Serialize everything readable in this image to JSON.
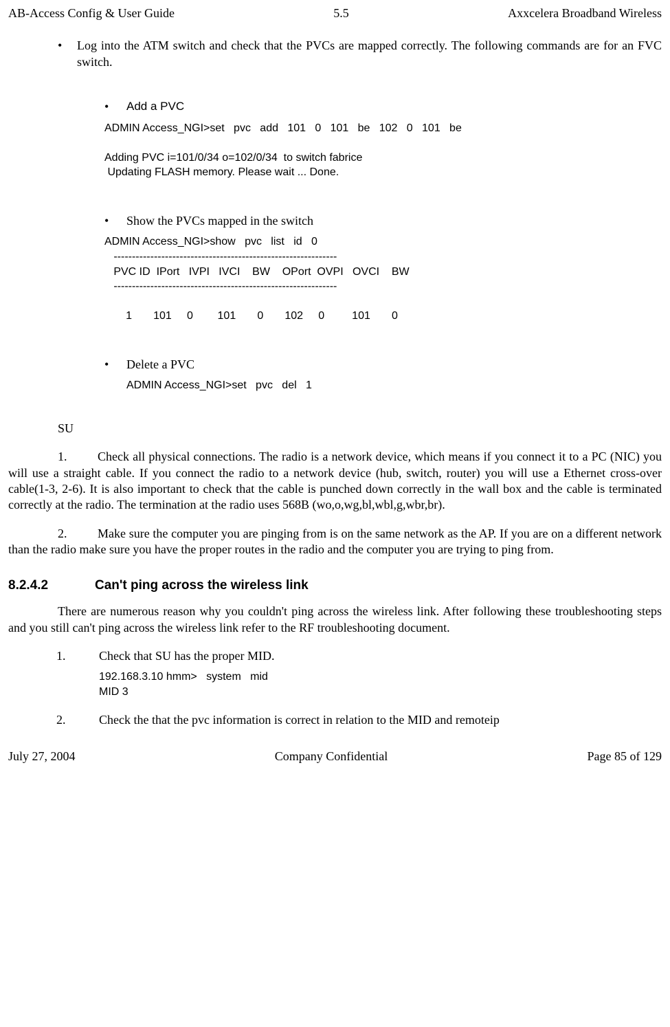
{
  "header": {
    "left": "AB-Access Config & User Guide",
    "center": "5.5",
    "right": "Axxcelera Broadband Wireless"
  },
  "footer": {
    "left": "July 27, 2004",
    "center": "Company Confidential",
    "right": "Page 85 of 129"
  },
  "mainBullet": "Log into the ATM switch and check that the PVCs are mapped correctly. The following commands are for an FVC switch.",
  "addPvc": {
    "title": "Add a PVC",
    "code": "ADMIN Access_NGI>set   pvc   add   101   0   101   be   102   0   101   be\n\nAdding PVC i=101/0/34 o=102/0/34  to switch fabrice\n Updating FLASH memory. Please wait ... Done."
  },
  "showPvc": {
    "title": "Show the PVCs mapped in the switch",
    "code": "ADMIN Access_NGI>show   pvc   list   id   0\n   -------------------------------------------------------------\n   PVC ID  IPort   IVPI   IVCI    BW    OPort  OVPI   OVCI    BW\n   -------------------------------------------------------------\n\n       1       101     0        101       0       102     0         101       0"
  },
  "deletePvc": {
    "title": "Delete a PVC",
    "code": "ADMIN Access_NGI>set   pvc   del   1"
  },
  "su": "SU",
  "suItem1": {
    "num": "1.",
    "text": "Check all physical connections. The radio is a network device, which means if you connect it to a PC (NIC) you will use a straight cable. If you  connect the radio to a network device (hub, switch, router) you will use a Ethernet cross-over cable(1-3, 2-6). It is also important to check that the cable is punched down correctly in the wall box and the cable is terminated correctly at the radio. The termination at the radio uses 568B (wo,o,wg,bl,wbl,g,wbr,br)."
  },
  "suItem2": {
    "num": "2.",
    "text": "Make sure the computer you are pinging from is on the same network as the AP. If you are on a different network than the radio make sure you have the proper routes in the radio and the computer you are trying to ping from."
  },
  "section": {
    "num": "8.2.4.2",
    "title": "Can't ping across the wireless link"
  },
  "sectionPara": "There are numerous reason why you couldn't ping across the wireless link. After following these troubleshooting steps and you still can't ping across the wireless link refer to the RF troubleshooting document.",
  "step1": {
    "num": "1.",
    "text": "Check that SU has the proper MID.",
    "code": "192.168.3.10 hmm>   system   mid\nMID 3"
  },
  "step2": {
    "num": "2.",
    "text": "Check the that the pvc information is correct in relation to the MID and remoteip"
  }
}
